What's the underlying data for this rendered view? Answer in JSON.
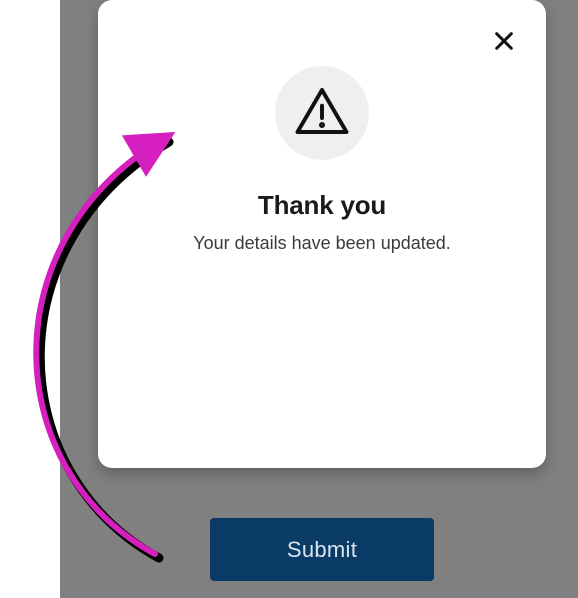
{
  "page": {
    "submit_label": "Submit"
  },
  "modal": {
    "title": "Thank you",
    "message": "Your details have been updated."
  }
}
